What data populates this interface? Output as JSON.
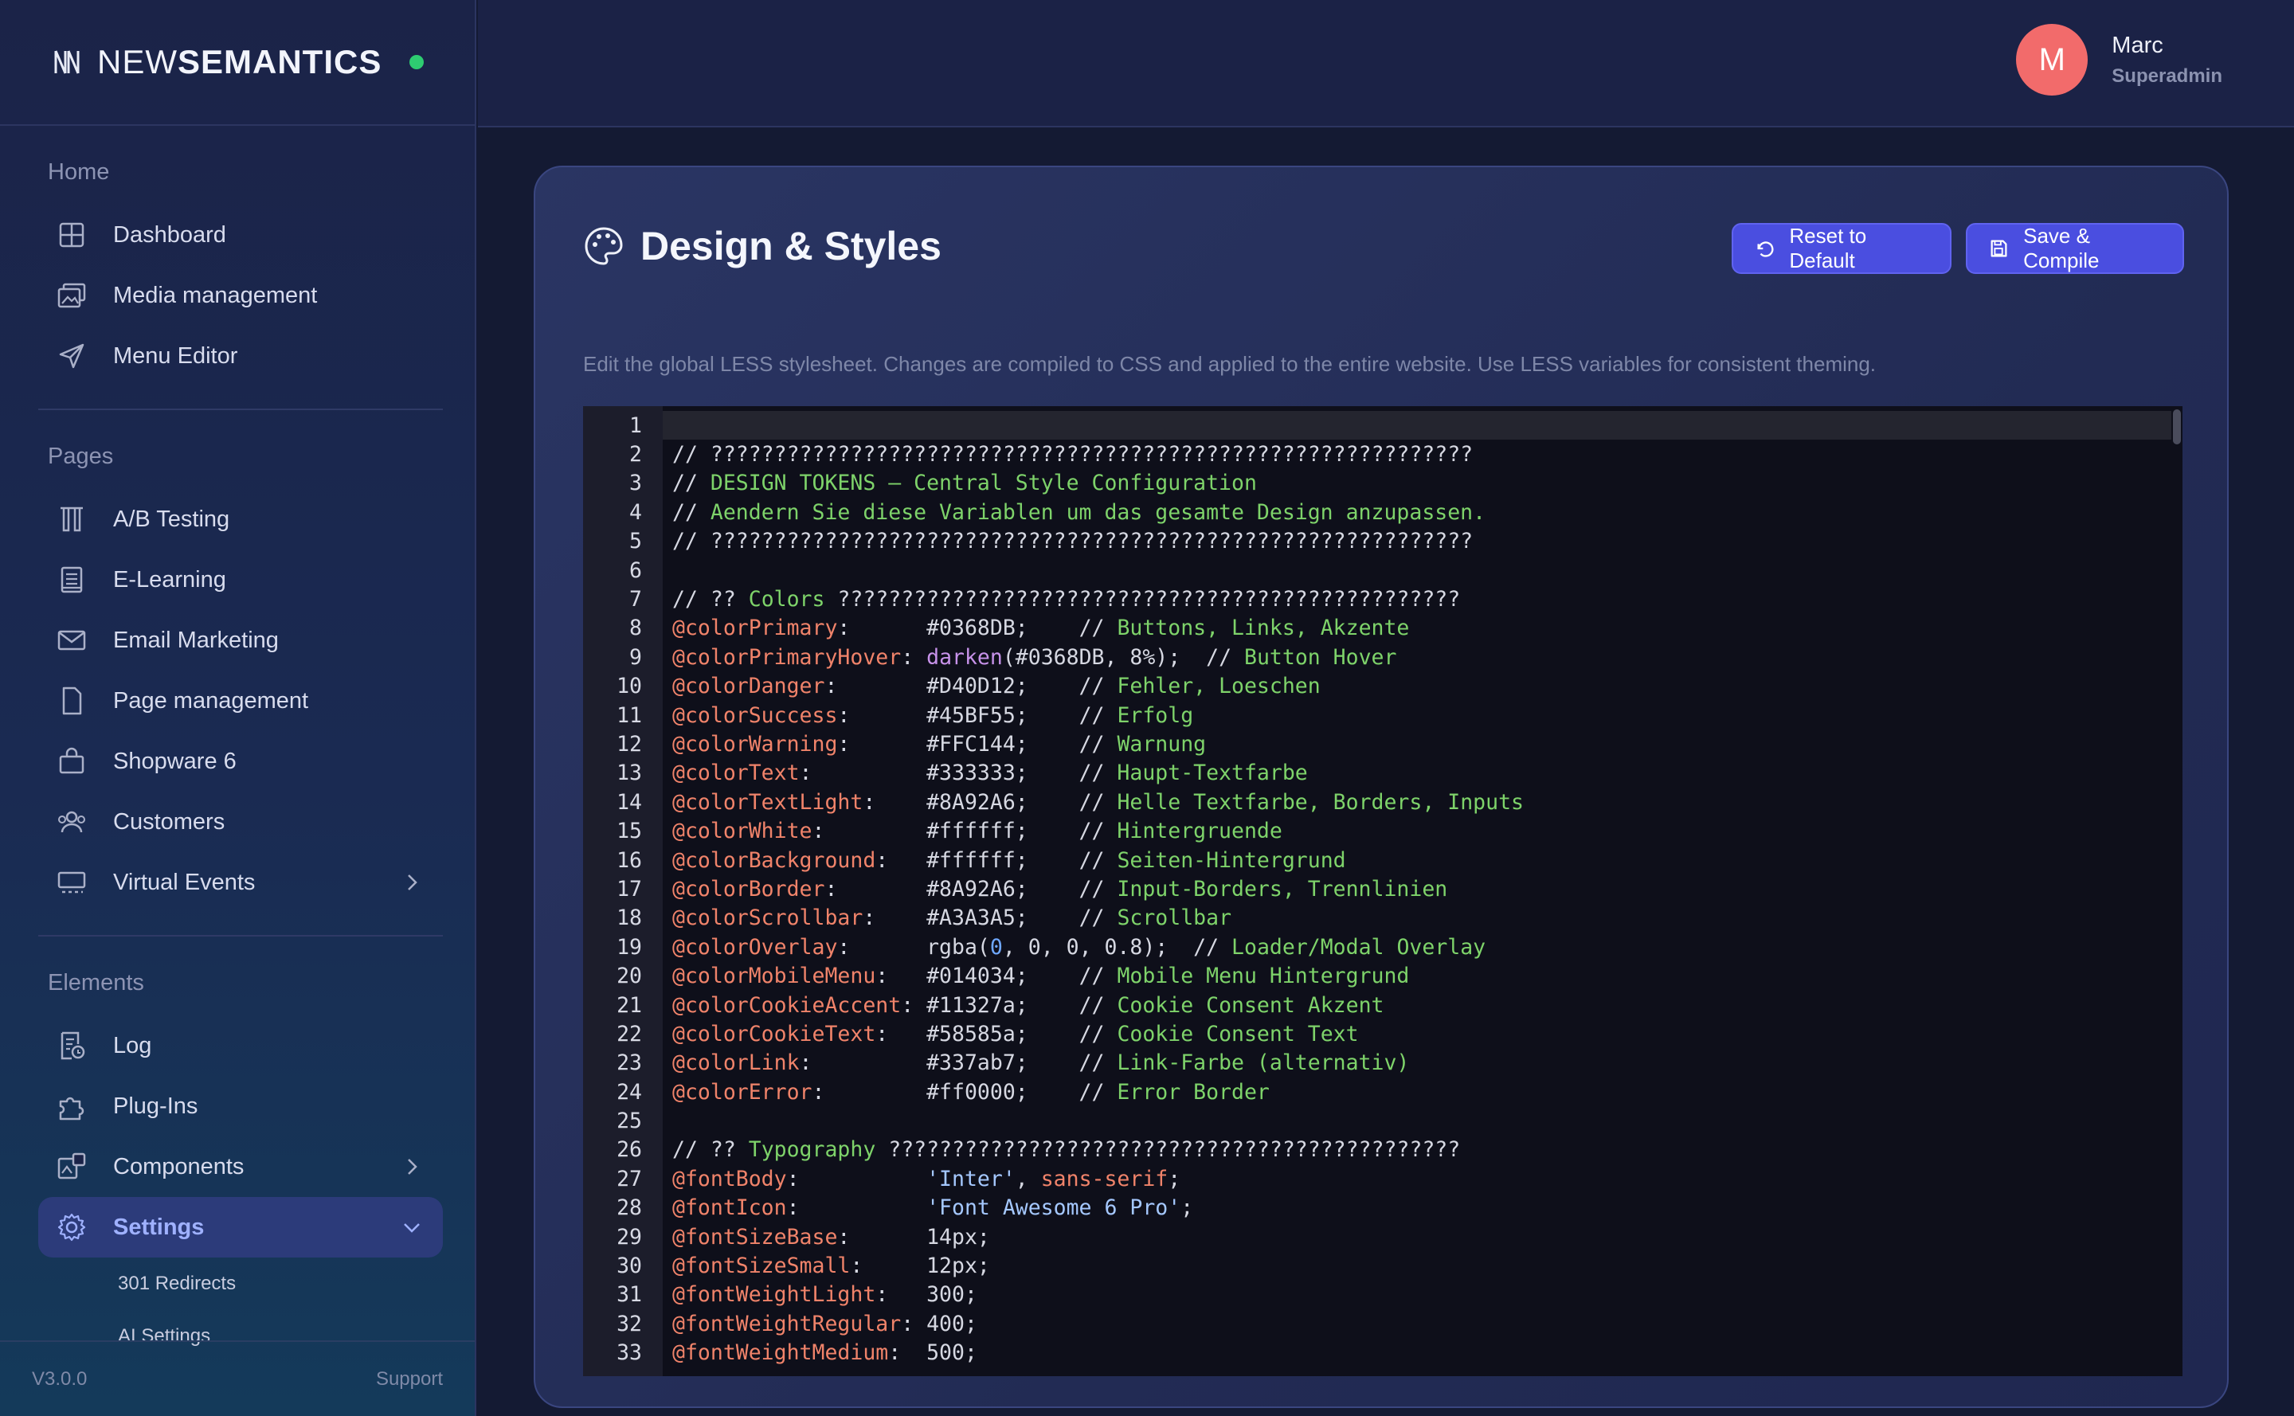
{
  "brand": {
    "name_light": "NEW",
    "name_bold": "SEMANTICS"
  },
  "user": {
    "initial": "M",
    "name": "Marc",
    "role": "Superadmin"
  },
  "sidebar": {
    "home_heading": "Home",
    "home_items": [
      {
        "label": "Dashboard",
        "icon": "grid-icon"
      },
      {
        "label": "Media management",
        "icon": "images-icon"
      },
      {
        "label": "Menu Editor",
        "icon": "send-icon"
      }
    ],
    "pages_heading": "Pages",
    "pages_items": [
      {
        "label": "A/B Testing",
        "icon": "ab-testing-icon"
      },
      {
        "label": "E-Learning",
        "icon": "book-icon"
      },
      {
        "label": "Email Marketing",
        "icon": "mail-icon"
      },
      {
        "label": "Page management",
        "icon": "file-icon"
      },
      {
        "label": "Shopware 6",
        "icon": "shopping-bag-icon"
      },
      {
        "label": "Customers",
        "icon": "users-icon"
      },
      {
        "label": "Virtual Events",
        "icon": "monitor-icon"
      }
    ],
    "elements_heading": "Elements",
    "elements_items": [
      {
        "label": "Log",
        "icon": "log-icon"
      },
      {
        "label": "Plug-Ins",
        "icon": "puzzle-icon"
      },
      {
        "label": "Components",
        "icon": "components-icon"
      },
      {
        "label": "Settings",
        "icon": "gear-icon"
      }
    ],
    "settings_sub": [
      "301 Redirects",
      "AI Settings"
    ],
    "footer_version": "V3.0.0",
    "footer_support": "Support"
  },
  "page": {
    "title": "Design & Styles",
    "reset_label": "Reset to Default",
    "save_label": "Save & Compile",
    "description": "Edit the global LESS stylesheet. Changes are compiled to CSS and applied to the entire website. Use LESS variables for consistent theming."
  },
  "editor": {
    "lines": [
      "",
      "// ????????????????????????????????????????????????????????????",
      "// DESIGN TOKENS – Central Style Configuration",
      "// Aendern Sie diese Variablen um das gesamte Design anzupassen.",
      "// ????????????????????????????????????????????????????????????",
      "",
      "// ?? Colors ?????????????????????????????????????????????????",
      "@colorPrimary:      #0368DB;    // Buttons, Links, Akzente",
      "@colorPrimaryHover: darken(#0368DB, 8%);  // Button Hover",
      "@colorDanger:       #D40D12;    // Fehler, Loeschen",
      "@colorSuccess:      #45BF55;    // Erfolg",
      "@colorWarning:      #FFC144;    // Warnung",
      "@colorText:         #333333;    // Haupt-Textfarbe",
      "@colorTextLight:    #8A92A6;    // Helle Textfarbe, Borders, Inputs",
      "@colorWhite:        #ffffff;    // Hintergruende",
      "@colorBackground:   #ffffff;    // Seiten-Hintergrund",
      "@colorBorder:       #8A92A6;    // Input-Borders, Trennlinien",
      "@colorScrollbar:    #A3A3A5;    // Scrollbar",
      "@colorOverlay:      rgba(0, 0, 0, 0.8);  // Loader/Modal Overlay",
      "@colorMobileMenu:   #014034;    // Mobile Menu Hintergrund",
      "@colorCookieAccent: #11327a;    // Cookie Consent Akzent",
      "@colorCookieText:   #58585a;    // Cookie Consent Text",
      "@colorLink:         #337ab7;    // Link-Farbe (alternativ)",
      "@colorError:        #ff0000;    // Error Border",
      "",
      "// ?? Typography ?????????????????????????????????????????????",
      "@fontBody:          'Inter', sans-serif;",
      "@fontIcon:          'Font Awesome 6 Pro';",
      "@fontSizeBase:      14px;",
      "@fontSizeSmall:     12px;",
      "@fontWeightLight:   300;",
      "@fontWeightRegular: 400;",
      "@fontWeightMedium:  500;"
    ]
  },
  "colors": {
    "accent": "#4a4ee0",
    "status_online": "#2ecc71",
    "avatar": "#f26b6b"
  }
}
